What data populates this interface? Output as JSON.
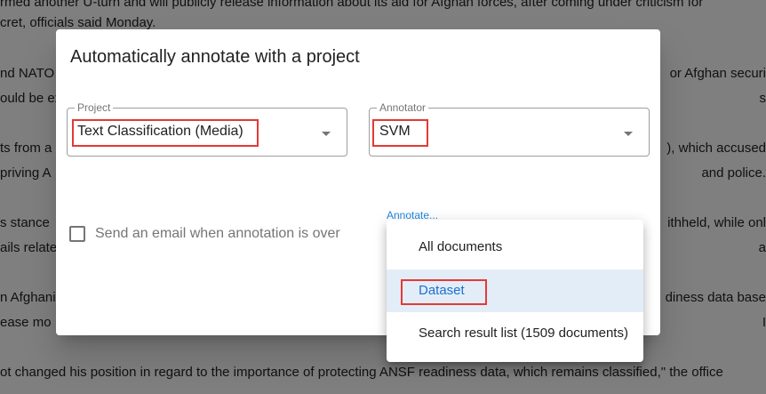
{
  "background": {
    "lines": [
      {
        "left": "rmed another U-turn and will publicly release information about its aid for Afghan forces, after coming under criticism for",
        "right": ""
      },
      {
        "left": "cret, officials said Monday.",
        "right": ""
      },
      {
        "left": "nd NATO t",
        "right": "or Afghan securi"
      },
      {
        "left": "ould be ex",
        "right": "s"
      },
      {
        "left": "ts from a",
        "right": "), which accused"
      },
      {
        "left": "priving A",
        "right": "and police."
      },
      {
        "left": "s stance",
        "right": "ithheld, while onl"
      },
      {
        "left": "ails relate",
        "right": "a"
      },
      {
        "left": "n Afghani",
        "right": "diness data base"
      },
      {
        "left": "ease mo",
        "right": "I"
      },
      {
        "left": "ot changed his position in regard to the importance of protecting ANSF readiness data, which remains classified,\" the office",
        "right": ""
      }
    ]
  },
  "dialog": {
    "title": "Automatically annotate with a project",
    "project": {
      "legend": "Project",
      "value": "Text Classification (Media)"
    },
    "annotator": {
      "legend": "Annotator",
      "value": "SVM"
    },
    "email_checkbox": {
      "label": "Send an email when annotation is over",
      "checked": false
    },
    "annotate_label": "Annotate..."
  },
  "menu": {
    "items": [
      {
        "label": "All documents",
        "selected": false
      },
      {
        "label": "Dataset",
        "selected": true
      },
      {
        "label": "Search result list (1509 documents)",
        "selected": false
      }
    ]
  },
  "colors": {
    "accent": "#1e88e5",
    "highlight": "#e53935",
    "selected_bg": "#e3edf8"
  }
}
